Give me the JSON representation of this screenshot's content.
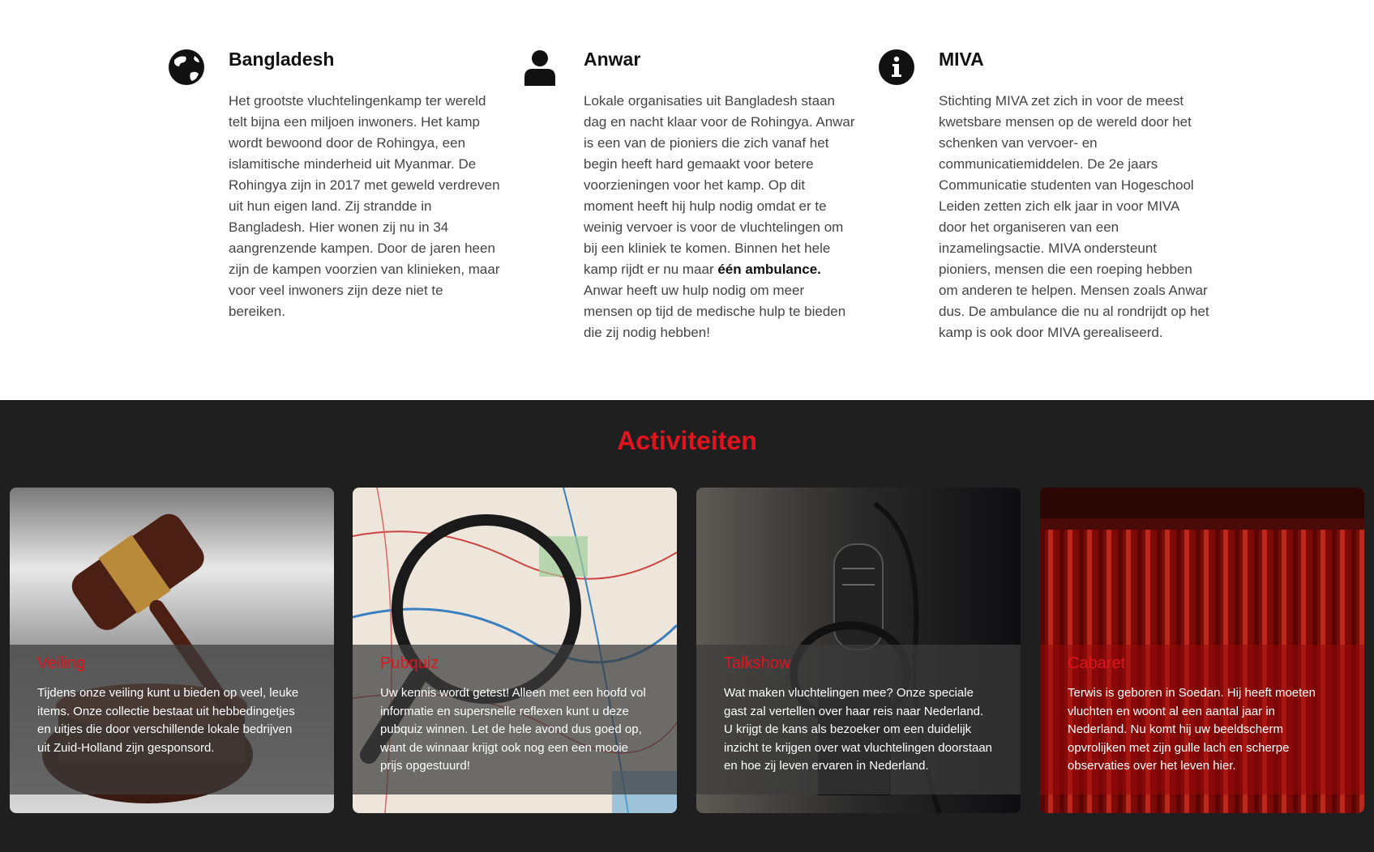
{
  "info_columns": [
    {
      "icon": "globe-icon",
      "title": "Bangladesh",
      "text": "Het grootste vluchtelingenkamp ter wereld telt bijna een miljoen inwoners. Het kamp wordt bewoond door de Rohingya, een islamitische minderheid uit Myanmar. De Rohingya zijn in 2017 met geweld verdreven uit hun eigen land. Zij strandde in Bangladesh. Hier wonen zij nu in 34 aangrenzende kampen. Door de jaren heen zijn de kampen voorzien van klinieken, maar voor veel inwoners zijn deze niet te bereiken."
    },
    {
      "icon": "user-icon",
      "title": "Anwar",
      "text_before": "Lokale organisaties uit Bangladesh staan dag en nacht klaar voor de Rohingya. Anwar is een van de pioniers die zich vanaf het begin heeft hard gemaakt voor betere voorzieningen voor het kamp. Op dit moment heeft hij hulp nodig omdat er te weinig vervoer is voor de vluchtelingen om bij een kliniek te komen. Binnen het hele kamp rijdt er nu maar ",
      "text_bold": "één ambulance.",
      "text_after": " Anwar heeft uw hulp nodig om meer mensen op tijd de medische hulp te bieden die zij nodig hebben!"
    },
    {
      "icon": "info-icon",
      "title": "MIVA",
      "text": "Stichting MIVA zet zich in voor de meest kwetsbare mensen op de wereld door het schenken van vervoer- en communicatiemiddelen. De 2e jaars Communicatie studenten van Hogeschool Leiden zetten zich elk jaar in voor MIVA door het organiseren van een inzamelingsactie. MIVA ondersteunt pioniers, mensen die een roeping hebben om anderen te helpen. Mensen zoals Anwar dus. De ambulance die nu al rondrijdt op het kamp is ook door MIVA gerealiseerd."
    }
  ],
  "activities": {
    "heading": "Activiteiten",
    "accent_color": "#e0141e",
    "cards": [
      {
        "title": "Veiling",
        "image": "gavel-image",
        "text": "Tijdens onze veiling kunt u bieden op veel, leuke items. Onze collectie bestaat uit hebbedingetjes en uitjes die door verschillende lokale bedrijven uit Zuid-Holland zijn gesponsord."
      },
      {
        "title": "Pubquiz",
        "image": "magnifier-map-image",
        "text": "Uw kennis wordt getest! Alleen met een hoofd vol informatie en supersnelle reflexen kunt u deze pubquiz winnen. Let de hele avond dus goed op, want de winnaar krijgt ook nog een een mooie prijs opgestuurd!"
      },
      {
        "title": "Talkshow",
        "image": "microphone-image",
        "text": "Wat maken vluchtelingen mee? Onze speciale gast zal vertellen over haar reis naar Nederland. U krijgt de kans als bezoeker om een duidelijk inzicht te krijgen over wat vluchtelingen doorstaan en hoe zij leven ervaren in Nederland."
      },
      {
        "title": "Cabaret",
        "image": "stage-curtain-image",
        "text": "Terwis is geboren in Soedan. Hij heeft moeten vluchten en woont al een aantal jaar in Nederland. Nu komt hij uw beeldscherm opvrolijken met zijn gulle lach en scherpe observaties over het leven hier."
      }
    ]
  }
}
